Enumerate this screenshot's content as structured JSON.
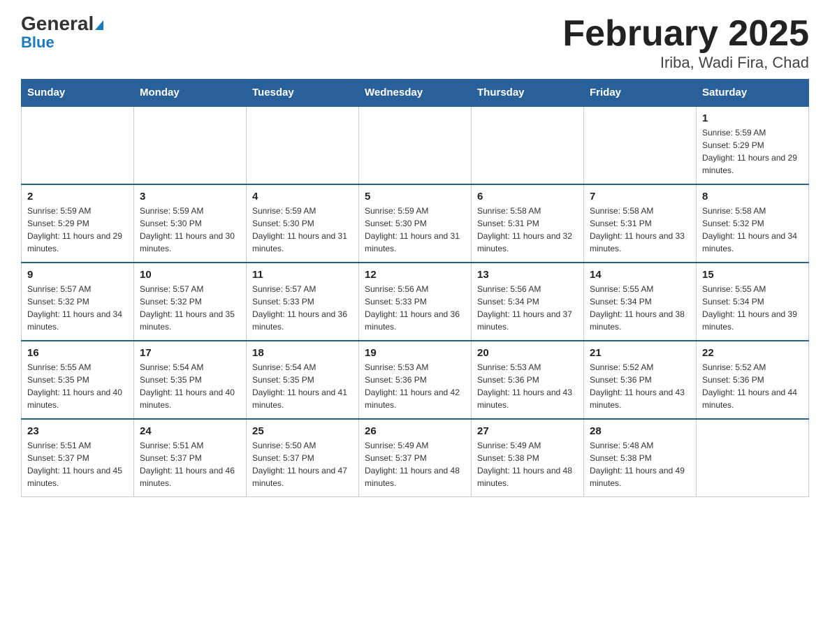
{
  "logo": {
    "general": "General",
    "blue": "Blue"
  },
  "title": "February 2025",
  "subtitle": "Iriba, Wadi Fira, Chad",
  "days_of_week": [
    "Sunday",
    "Monday",
    "Tuesday",
    "Wednesday",
    "Thursday",
    "Friday",
    "Saturday"
  ],
  "weeks": [
    [
      {
        "day": "",
        "info": ""
      },
      {
        "day": "",
        "info": ""
      },
      {
        "day": "",
        "info": ""
      },
      {
        "day": "",
        "info": ""
      },
      {
        "day": "",
        "info": ""
      },
      {
        "day": "",
        "info": ""
      },
      {
        "day": "1",
        "info": "Sunrise: 5:59 AM\nSunset: 5:29 PM\nDaylight: 11 hours and 29 minutes."
      }
    ],
    [
      {
        "day": "2",
        "info": "Sunrise: 5:59 AM\nSunset: 5:29 PM\nDaylight: 11 hours and 29 minutes."
      },
      {
        "day": "3",
        "info": "Sunrise: 5:59 AM\nSunset: 5:30 PM\nDaylight: 11 hours and 30 minutes."
      },
      {
        "day": "4",
        "info": "Sunrise: 5:59 AM\nSunset: 5:30 PM\nDaylight: 11 hours and 31 minutes."
      },
      {
        "day": "5",
        "info": "Sunrise: 5:59 AM\nSunset: 5:30 PM\nDaylight: 11 hours and 31 minutes."
      },
      {
        "day": "6",
        "info": "Sunrise: 5:58 AM\nSunset: 5:31 PM\nDaylight: 11 hours and 32 minutes."
      },
      {
        "day": "7",
        "info": "Sunrise: 5:58 AM\nSunset: 5:31 PM\nDaylight: 11 hours and 33 minutes."
      },
      {
        "day": "8",
        "info": "Sunrise: 5:58 AM\nSunset: 5:32 PM\nDaylight: 11 hours and 34 minutes."
      }
    ],
    [
      {
        "day": "9",
        "info": "Sunrise: 5:57 AM\nSunset: 5:32 PM\nDaylight: 11 hours and 34 minutes."
      },
      {
        "day": "10",
        "info": "Sunrise: 5:57 AM\nSunset: 5:32 PM\nDaylight: 11 hours and 35 minutes."
      },
      {
        "day": "11",
        "info": "Sunrise: 5:57 AM\nSunset: 5:33 PM\nDaylight: 11 hours and 36 minutes."
      },
      {
        "day": "12",
        "info": "Sunrise: 5:56 AM\nSunset: 5:33 PM\nDaylight: 11 hours and 36 minutes."
      },
      {
        "day": "13",
        "info": "Sunrise: 5:56 AM\nSunset: 5:34 PM\nDaylight: 11 hours and 37 minutes."
      },
      {
        "day": "14",
        "info": "Sunrise: 5:55 AM\nSunset: 5:34 PM\nDaylight: 11 hours and 38 minutes."
      },
      {
        "day": "15",
        "info": "Sunrise: 5:55 AM\nSunset: 5:34 PM\nDaylight: 11 hours and 39 minutes."
      }
    ],
    [
      {
        "day": "16",
        "info": "Sunrise: 5:55 AM\nSunset: 5:35 PM\nDaylight: 11 hours and 40 minutes."
      },
      {
        "day": "17",
        "info": "Sunrise: 5:54 AM\nSunset: 5:35 PM\nDaylight: 11 hours and 40 minutes."
      },
      {
        "day": "18",
        "info": "Sunrise: 5:54 AM\nSunset: 5:35 PM\nDaylight: 11 hours and 41 minutes."
      },
      {
        "day": "19",
        "info": "Sunrise: 5:53 AM\nSunset: 5:36 PM\nDaylight: 11 hours and 42 minutes."
      },
      {
        "day": "20",
        "info": "Sunrise: 5:53 AM\nSunset: 5:36 PM\nDaylight: 11 hours and 43 minutes."
      },
      {
        "day": "21",
        "info": "Sunrise: 5:52 AM\nSunset: 5:36 PM\nDaylight: 11 hours and 43 minutes."
      },
      {
        "day": "22",
        "info": "Sunrise: 5:52 AM\nSunset: 5:36 PM\nDaylight: 11 hours and 44 minutes."
      }
    ],
    [
      {
        "day": "23",
        "info": "Sunrise: 5:51 AM\nSunset: 5:37 PM\nDaylight: 11 hours and 45 minutes."
      },
      {
        "day": "24",
        "info": "Sunrise: 5:51 AM\nSunset: 5:37 PM\nDaylight: 11 hours and 46 minutes."
      },
      {
        "day": "25",
        "info": "Sunrise: 5:50 AM\nSunset: 5:37 PM\nDaylight: 11 hours and 47 minutes."
      },
      {
        "day": "26",
        "info": "Sunrise: 5:49 AM\nSunset: 5:37 PM\nDaylight: 11 hours and 48 minutes."
      },
      {
        "day": "27",
        "info": "Sunrise: 5:49 AM\nSunset: 5:38 PM\nDaylight: 11 hours and 48 minutes."
      },
      {
        "day": "28",
        "info": "Sunrise: 5:48 AM\nSunset: 5:38 PM\nDaylight: 11 hours and 49 minutes."
      },
      {
        "day": "",
        "info": ""
      }
    ]
  ]
}
